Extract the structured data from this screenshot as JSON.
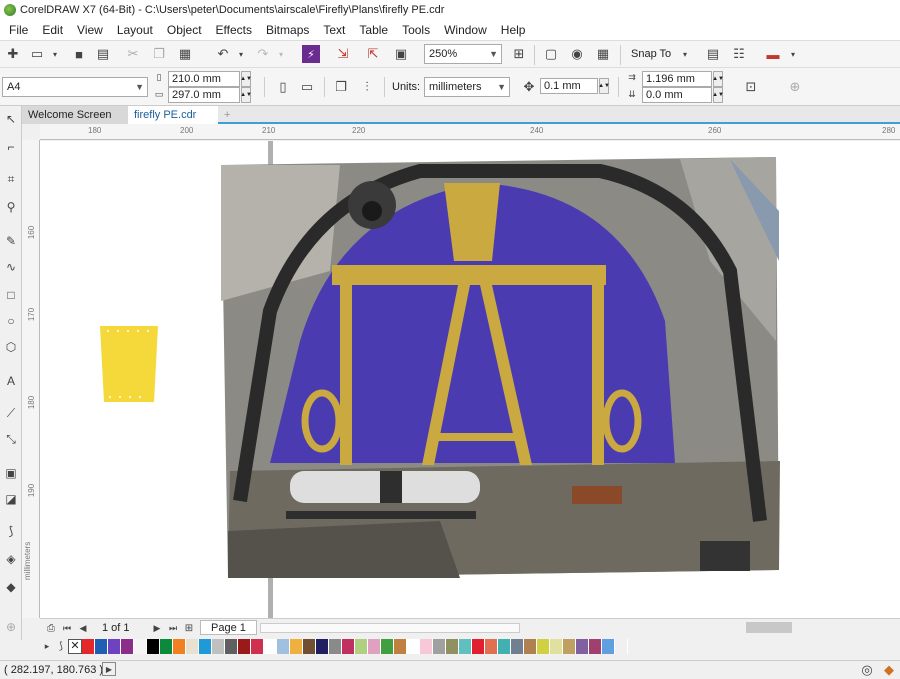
{
  "window": {
    "title": "CorelDRAW X7 (64-Bit) - C:\\Users\\peter\\Documents\\airscale\\Firefly\\Plans\\firefly PE.cdr"
  },
  "menu": [
    "File",
    "Edit",
    "View",
    "Layout",
    "Object",
    "Effects",
    "Bitmaps",
    "Text",
    "Table",
    "Tools",
    "Window",
    "Help"
  ],
  "toolbar": {
    "zoom": "250%",
    "snap_label": "Snap To"
  },
  "property_bar": {
    "page_size": "A4",
    "width": "210.0 mm",
    "height": "297.0 mm",
    "units_label": "Units:",
    "units": "millimeters",
    "nudge": "0.1 mm",
    "dup_x": "1.196 mm",
    "dup_y": "0.0 mm"
  },
  "tabs": [
    {
      "label": "Welcome Screen"
    },
    {
      "label": "firefly PE.cdr",
      "active": true
    }
  ],
  "ruler_h": [
    "180",
    "200",
    "210",
    "220",
    "240",
    "260",
    "280"
  ],
  "ruler_v": [
    "160",
    "170",
    "180",
    "190"
  ],
  "ruler_unit": "millimeters",
  "page_nav": {
    "current": "1 of 1",
    "page_tab": "Page 1"
  },
  "palette": [
    "#e22828",
    "#1e5fb4",
    "#6f42c1",
    "#8b2d8b",
    "#f5f5f5",
    "#000000",
    "#0a8a3a",
    "#f08020",
    "#e8e0d0",
    "#1e9bd7",
    "#c0c0c0",
    "#606060",
    "#9a1a1a",
    "#d03050",
    "#ffffff",
    "#a0c0e0",
    "#f0b040",
    "#705030",
    "#202060",
    "#8a8a8a",
    "#c03060",
    "#b0d080",
    "#e0a0c0",
    "#40a040",
    "#c08040",
    "#ffffff",
    "#f8c8d8",
    "#a0a0a0",
    "#909060",
    "#60c0c0",
    "#e02030",
    "#e07050",
    "#40b0b0",
    "#708090",
    "#b08050",
    "#d0d040",
    "#e0e0a0",
    "#c0a060",
    "#8060a0",
    "#a04070",
    "#60a0e0",
    "#f0f0f0"
  ],
  "status": {
    "coords": "( 282.197, 180.763 )"
  }
}
